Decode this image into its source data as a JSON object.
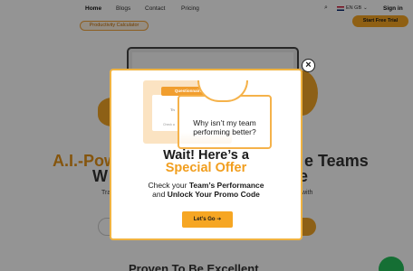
{
  "nav": {
    "links": [
      "Home",
      "Blogs",
      "Contact",
      "Pricing"
    ],
    "search_icon": "search-icon",
    "language": "EN GB",
    "sign_in": "Sign in",
    "cta": "Start Free Trial"
  },
  "hero": {
    "pill": "Productivity Calculator",
    "title_line1": "A.I.-Pow",
    "title_line1_right": "e Teams",
    "title_line2_left": "W",
    "title_line2_right": "e",
    "subtitle_left": "Tra",
    "subtitle_right": "with",
    "section_heading": "Proven To Be Excellent"
  },
  "modal": {
    "illustration": {
      "card_label": "Questionnaire",
      "card_line1": "Th",
      "card_line2": "Check a"
    },
    "question": "Why isn’t my team performing better?",
    "headline": "Wait! Here’s a",
    "headline_highlight": "Special Offer",
    "body_prefix": "Check your ",
    "body_bold1": "Team’s Performance",
    "body_prefix2": "and ",
    "body_bold2": "Unlock Your Promo Code",
    "button": "Let’s Go",
    "button_icon": "arrow-right-icon",
    "close_icon": "close-icon"
  },
  "colors": {
    "accent": "#f6a623",
    "accent_text": "#f19e1e",
    "overlay": "rgba(0,0,0,0.42)",
    "whatsapp": "#25c05a"
  }
}
